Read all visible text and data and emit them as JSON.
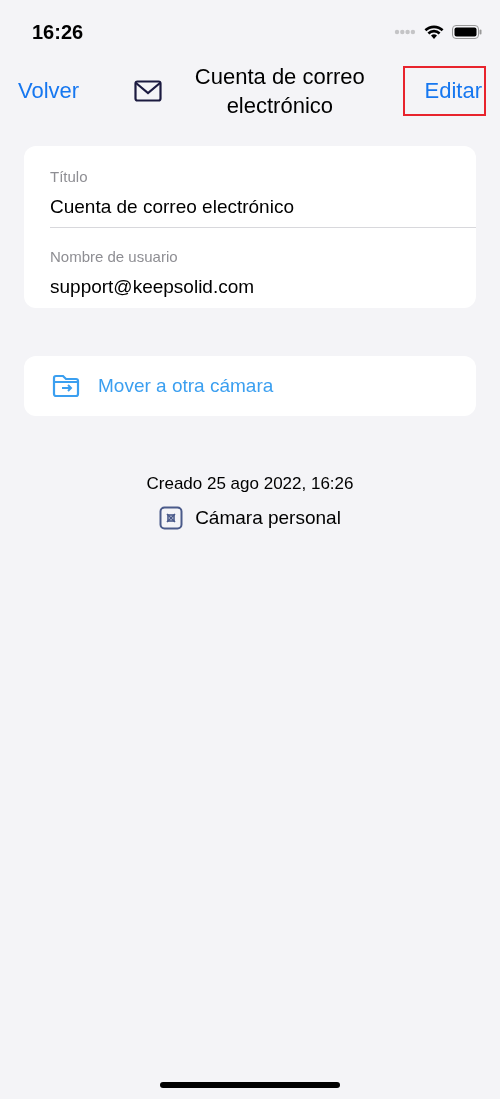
{
  "status_bar": {
    "time": "16:26"
  },
  "nav": {
    "back": "Volver",
    "title": "Cuenta de correo electrónico",
    "edit": {
      "label": "Editar",
      "highlighted": true
    }
  },
  "fields": [
    {
      "label": "Título",
      "value": "Cuenta de correo electrónico"
    },
    {
      "label": "Nombre de usuario",
      "value": "support@keepsolid.com"
    }
  ],
  "move_action": "Mover a otra cámara",
  "created": "Creado 25 ago 2022, 16:26",
  "vault": "Cámara personal"
}
